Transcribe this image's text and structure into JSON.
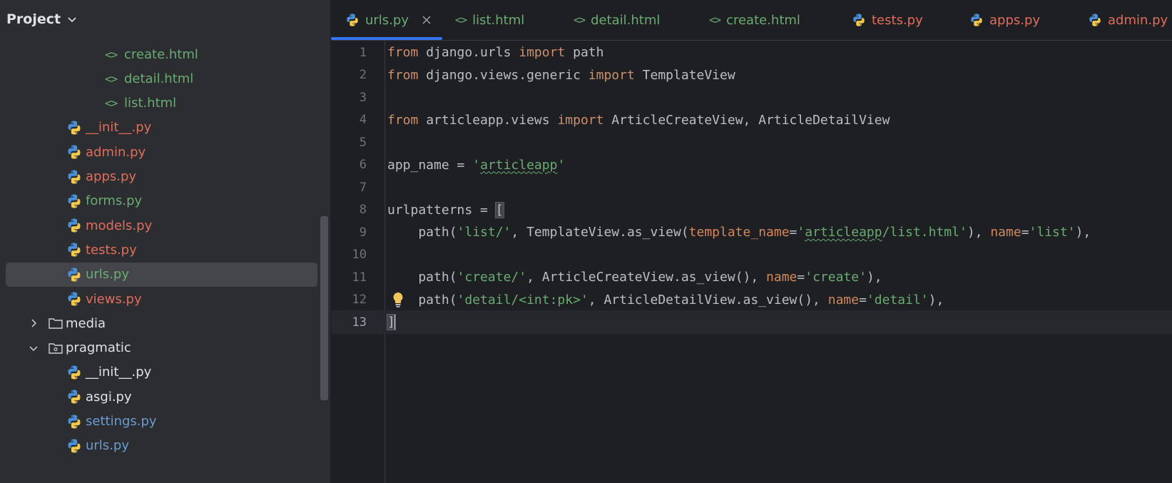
{
  "panel": {
    "title": "Project"
  },
  "tree": [
    {
      "label": "create.html",
      "kind": "html",
      "color": "green"
    },
    {
      "label": "detail.html",
      "kind": "html",
      "color": "green"
    },
    {
      "label": "list.html",
      "kind": "html",
      "color": "green"
    },
    {
      "label": "__init__.py",
      "kind": "py",
      "color": "red"
    },
    {
      "label": "admin.py",
      "kind": "py",
      "color": "red"
    },
    {
      "label": "apps.py",
      "kind": "py",
      "color": "red"
    },
    {
      "label": "forms.py",
      "kind": "py",
      "color": "green"
    },
    {
      "label": "models.py",
      "kind": "py",
      "color": "red"
    },
    {
      "label": "tests.py",
      "kind": "py",
      "color": "red"
    },
    {
      "label": "urls.py",
      "kind": "py",
      "color": "green",
      "selected": true
    },
    {
      "label": "views.py",
      "kind": "py",
      "color": "red"
    },
    {
      "label": "media",
      "kind": "folder",
      "expanded": false
    },
    {
      "label": "pragmatic",
      "kind": "folder",
      "expanded": true
    },
    {
      "label": "__init__.py",
      "kind": "py",
      "color": "default"
    },
    {
      "label": "asgi.py",
      "kind": "py",
      "color": "default"
    },
    {
      "label": "settings.py",
      "kind": "py",
      "color": "blue"
    },
    {
      "label": "urls.py",
      "kind": "py",
      "color": "blue"
    }
  ],
  "tabs": [
    {
      "label": "urls.py",
      "kind": "py",
      "color": "#6aab73",
      "active": true
    },
    {
      "label": "list.html",
      "kind": "html",
      "color": "#6aab73"
    },
    {
      "label": "detail.html",
      "kind": "html",
      "color": "#6aab73"
    },
    {
      "label": "create.html",
      "kind": "html",
      "color": "#6aab73"
    },
    {
      "label": "tests.py",
      "kind": "py",
      "color": "#e16d5c"
    },
    {
      "label": "apps.py",
      "kind": "py",
      "color": "#e16d5c"
    },
    {
      "label": "admin.py",
      "kind": "py",
      "color": "#e16d5c"
    }
  ],
  "editor": {
    "current_line": 13,
    "lines": [
      {
        "n": "1",
        "text": "from django.urls import path"
      },
      {
        "n": "2",
        "text": "from django.views.generic import TemplateView"
      },
      {
        "n": "3",
        "text": ""
      },
      {
        "n": "4",
        "text": "from articleapp.views import ArticleCreateView, ArticleDetailView"
      },
      {
        "n": "5",
        "text": ""
      },
      {
        "n": "6",
        "text": "app_name = 'articleapp'"
      },
      {
        "n": "7",
        "text": ""
      },
      {
        "n": "8",
        "text": "urlpatterns = ["
      },
      {
        "n": "9",
        "text": "    path('list/', TemplateView.as_view(template_name='articleapp/list.html'), name='list'),"
      },
      {
        "n": "10",
        "text": ""
      },
      {
        "n": "11",
        "text": "    path('create/', ArticleCreateView.as_view(), name='create'),"
      },
      {
        "n": "12",
        "text": "    path('detail/<int:pk>', ArticleDetailView.as_view(), name='detail'),"
      },
      {
        "n": "13",
        "text": "]"
      }
    ]
  },
  "colors": {
    "keyword": "#cf8e6d",
    "string": "#6aab73",
    "parameter": "#d5875b",
    "text": "#bcbec4",
    "accent": "#3574f0"
  },
  "icons": {
    "python": "python-icon",
    "html": "html-tag-icon",
    "folder": "folder-icon",
    "close": "close-icon",
    "bulb": "lightbulb-icon"
  }
}
